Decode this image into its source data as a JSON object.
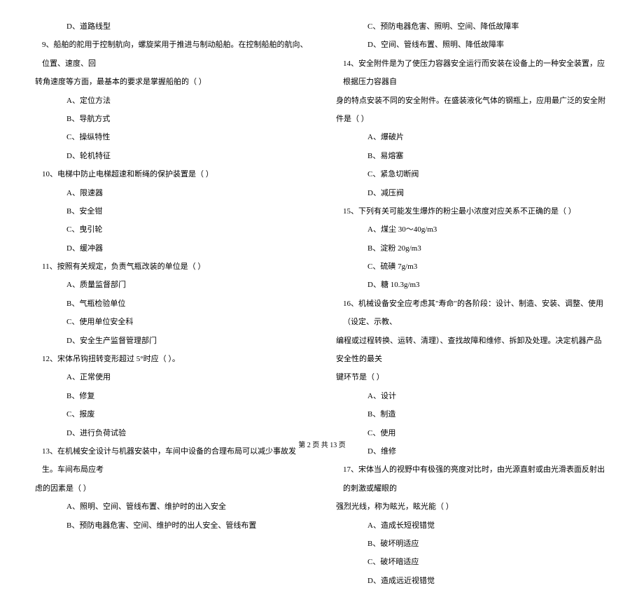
{
  "left": {
    "l1": "D、道路线型",
    "l2": "9、船舶的舵用于控制航向，螺旋桨用于推进与制动船舶。在控制船舶的航向、位置、速度、回",
    "l3": "转角速度等方面，最基本的要求是掌握船舶的（    ）",
    "l4": "A、定位方法",
    "l5": "B、导航方式",
    "l6": "C、操纵特性",
    "l7": "D、轮机特征",
    "l8": "10、电梯中防止电梯超速和断绳的保护装置是（    ）",
    "l9": "A、限速器",
    "l10": "B、安全钳",
    "l11": "C、曳引轮",
    "l12": "D、缓冲器",
    "l13": "11、按照有关规定，负责气瓶改装的单位是（    ）",
    "l14": "A、质量监督部门",
    "l15": "B、气瓶检验单位",
    "l16": "C、使用单位安全科",
    "l17": "D、安全生产监督管理部门",
    "l18": "12、宋体吊钩扭转变形超过 5°时应（    ）。",
    "l19": "A、正常使用",
    "l20": "B、修复",
    "l21": "C、报废",
    "l22": "D、进行负荷试验",
    "l23": "13、在机械安全设计与机器安装中，车间中设备的合理布局可以减少事故发生。车间布局应考",
    "l24": "虑的因素是（    ）",
    "l25": "A、照明、空间、管线布置、维护时的出入安全",
    "l26": "B、预防电器危害、空间、维护时的出人安全、管线布置"
  },
  "right": {
    "r1": "C、预防电器危害、照明、空间、降低故障率",
    "r2": "D、空间、管线布置、照明、降低故障率",
    "r3": "14、安全附件是为了使压力容器安全运行而安装在设备上的一种安全装置，应根据压力容器自",
    "r4": "身的特点安装不同的安全附件。在盛装液化气体的钢瓶上，应用最广泛的安全附件是（     ）",
    "r5": "A、爆破片",
    "r6": "B、易熔塞",
    "r7": "C、紧急切断阀",
    "r8": "D、减压阀",
    "r9": "15、下列有关可能发生爆炸的粉尘最小浓度对应关系不正确的是（     ）",
    "r10": "A、煤尘 30～40g/m3",
    "r11": "B、淀粉 20g/m3",
    "r12": "C、硫磺 7g/m3",
    "r13": "D、糖 10.3g/m3",
    "r14": "16、机械设备安全应考虑其\"寿命\"的各阶段：设计、制造、安装、调整、使用（设定、示教、",
    "r15": "编程或过程转换、运转、清理）、查找故障和维修、拆卸及处理。决定机器产品安全性的最关",
    "r16": "键环节是（     ）",
    "r17": "A、设计",
    "r18": "B、制造",
    "r19": "C、使用",
    "r20": "D、维修",
    "r21": "17、宋体当人的视野中有极强的亮度对比时，由光源直射或由光滑表面反射出的刺激或耀眼的",
    "r22": "强烈光线，称为眩光，眩光能（     ）",
    "r23": "A、造成长短视错觉",
    "r24": "B、破坏明适应",
    "r25": "C、破坏暗适应",
    "r26": "D、造成远近视错觉"
  },
  "footer": "第 2 页 共 13 页"
}
